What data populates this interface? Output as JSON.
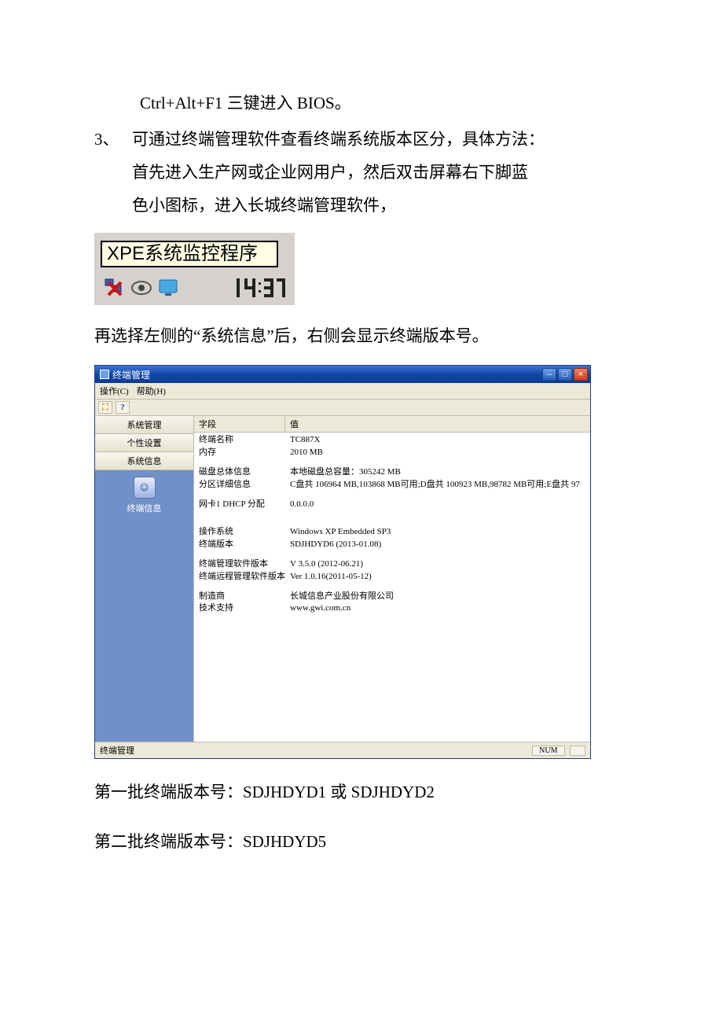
{
  "doc": {
    "line_bios": "Ctrl+Alt+F1 三键进入 BIOS。",
    "item3_num": "3、",
    "item3_l1": "可通过终端管理软件查看终端系统版本区分，具体方法：",
    "item3_l2": "首先进入生产网或企业网用户，然后双击屏幕右下脚蓝",
    "item3_l3": "色小图标，进入长城终端管理软件，",
    "tray_tooltip": "XPE系统监控程序",
    "tray_time": "14:37",
    "after_tray": "再选择左侧的“系统信息”后，右侧会显示终端版本号。",
    "v1": "第一批终端版本号：SDJHDYD1 或 SDJHDYD2",
    "v2": "第二批终端版本号：SDJHDYD5"
  },
  "win": {
    "title": "终端管理",
    "menu_op": "操作(C)",
    "menu_help": "帮助(H)",
    "side": {
      "b1": "系统管理",
      "b2": "个性设置",
      "b3": "系统信息",
      "icon_label": "终端信息"
    },
    "head_col1": "字段",
    "head_col2": "值",
    "rows": [
      {
        "k": "终端名称",
        "v": "TC887X"
      },
      {
        "k": "内存",
        "v": "2010 MB"
      }
    ],
    "rows2": [
      {
        "k": "磁盘总体信息",
        "v": "本地磁盘总容量：305242 MB"
      },
      {
        "k": "分区详细信息",
        "v": "C盘共 106964 MB,103868 MB可用;D盘共 100923 MB,98782 MB可用;E盘共 97"
      }
    ],
    "rows3": [
      {
        "k": "网卡1  DHCP 分配",
        "v": "0.0.0.0"
      }
    ],
    "rows4": [
      {
        "k": "操作系统",
        "v": "Windows XP Embedded SP3"
      },
      {
        "k": "终端版本",
        "v": "SDJHDYD6 (2013-01.08)"
      }
    ],
    "rows5": [
      {
        "k": "终端管理软件版本",
        "v": "V 3.5.0 (2012-06.21)"
      },
      {
        "k": "终端远程管理软件版本",
        "v": "Ver 1.0.16(2011-05-12)"
      }
    ],
    "rows6": [
      {
        "k": "制造商",
        "v": "长城信息产业股份有限公司"
      },
      {
        "k": "技术支持",
        "v": "www.gwi.com.cn"
      }
    ],
    "status_left": "终端管理",
    "status_num": "NUM"
  }
}
